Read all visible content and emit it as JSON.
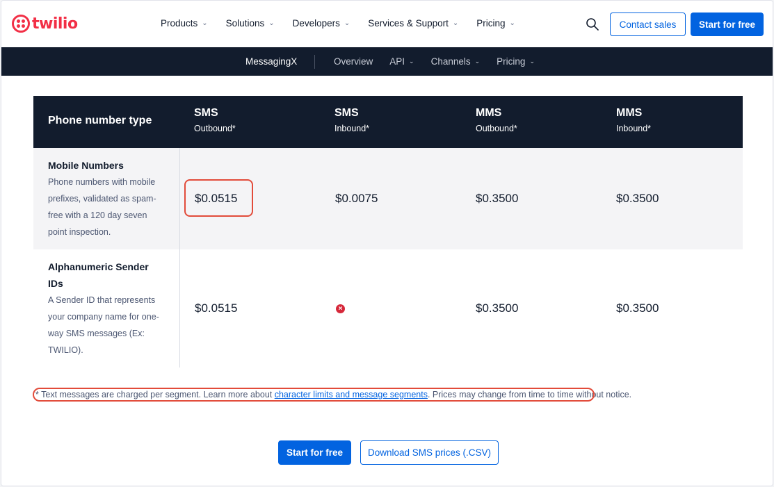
{
  "topnav": {
    "logo_text": "twilio",
    "menu": [
      {
        "label": "Products"
      },
      {
        "label": "Solutions"
      },
      {
        "label": "Developers"
      },
      {
        "label": "Services & Support"
      },
      {
        "label": "Pricing"
      }
    ],
    "contact_label": "Contact sales",
    "start_label": "Start for free"
  },
  "subnav": {
    "brand": "MessagingX",
    "links": [
      {
        "label": "Overview"
      },
      {
        "label": "API"
      },
      {
        "label": "Channels"
      },
      {
        "label": "Pricing"
      }
    ]
  },
  "table": {
    "headers": [
      {
        "title": "Phone number type",
        "sub": ""
      },
      {
        "title": "SMS",
        "sub": "Outbound*"
      },
      {
        "title": "SMS",
        "sub": "Inbound*"
      },
      {
        "title": "MMS",
        "sub": "Outbound*"
      },
      {
        "title": "MMS",
        "sub": "Inbound*"
      }
    ],
    "rows": [
      {
        "title": "Mobile Numbers",
        "desc": "Phone numbers with mobile prefixes, validated as spam-free with a 120 day seven point inspection.",
        "values": [
          "$0.0515",
          "$0.0075",
          "$0.3500",
          "$0.3500"
        ]
      },
      {
        "title": "Alphanumeric Sender IDs",
        "desc": "A Sender ID that represents your company name for one-way SMS messages (Ex: TWILIO).",
        "values": [
          "$0.0515",
          "",
          "$0.3500",
          "$0.3500"
        ],
        "unavailable_icon": "x-circle-icon"
      }
    ]
  },
  "footnote": {
    "before": "* Text messages are charged per segment. Learn more about ",
    "link": "character limits and message segments",
    "after": ". Prices may change from time to time without notice."
  },
  "bottom": {
    "start_label": "Start for free",
    "download_label": "Download SMS prices (.CSV)"
  },
  "colors": {
    "brand_red": "#f22f46",
    "primary_blue": "#0263e0",
    "navy": "#121c2d",
    "annotation_red": "#e24b3a"
  }
}
